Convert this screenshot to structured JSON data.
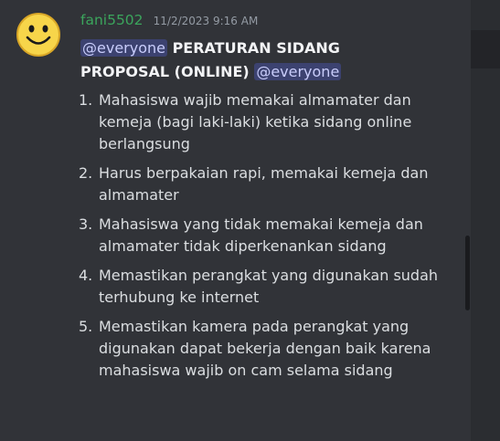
{
  "message": {
    "author": "fani5502",
    "timestamp": "11/2/2023 9:16 AM",
    "mention": "@everyone",
    "headline_line1": "PERATURAN SIDANG",
    "headline_line2": "PROPOSAL (ONLINE)",
    "avatar_icon": "smiley-face-icon",
    "rules": [
      {
        "num": "1.",
        "text": "Mahasiswa wajib memakai almamater dan kemeja (bagi laki-laki) ketika sidang online berlangsung"
      },
      {
        "num": "2.",
        "text": "Harus berpakaian rapi, memakai kemeja dan almamater"
      },
      {
        "num": "3.",
        "text": "Mahasiswa yang tidak memakai kemeja dan almamater tidak diperkenankan sidang"
      },
      {
        "num": "4.",
        "text": "Memastikan perangkat yang digunakan sudah terhubung ke internet"
      },
      {
        "num": "5.",
        "text": "Memastikan kamera pada perangkat yang digunakan dapat bekerja dengan baik karena mahasiswa wajib on cam selama sidang"
      }
    ]
  },
  "colors": {
    "background": "#313338",
    "username": "#3ba55c",
    "mention_bg": "#3c4270",
    "mention_text": "#c9cdfb"
  }
}
